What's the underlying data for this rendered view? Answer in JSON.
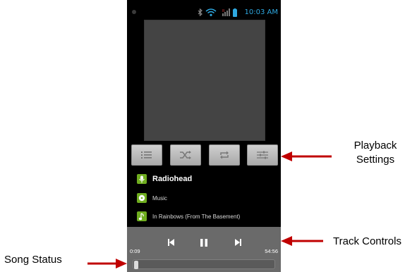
{
  "status_bar": {
    "time": "10:03 AM",
    "accent": "#2ea8e0"
  },
  "playback_settings": {
    "buttons": [
      "playlist-icon",
      "shuffle-icon",
      "repeat-icon",
      "equalizer-icon"
    ]
  },
  "track": {
    "artist": "Radiohead",
    "genre": "Music",
    "album": "In Rainbows (From The Basement)"
  },
  "controls": {
    "elapsed": "0:09",
    "duration": "54:56",
    "progress": 0.003
  },
  "callouts": {
    "playback_settings": "Playback\nSettings",
    "track_controls": "Track Controls",
    "song_status": "Song Status"
  },
  "colors": {
    "arrow": "#c00000",
    "icon_green": "#6fad1f"
  }
}
